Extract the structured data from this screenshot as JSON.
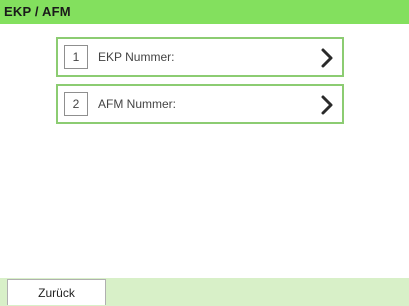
{
  "header": {
    "title": "EKP / AFM"
  },
  "menu": {
    "items": [
      {
        "number": "1",
        "label": "EKP Nummer:",
        "icon": "chevron-right-icon"
      },
      {
        "number": "2",
        "label": "AFM Nummer:",
        "icon": "chevron-right-icon"
      }
    ]
  },
  "footer": {
    "back_label": "Zurück"
  },
  "colors": {
    "title_bar": "#83e05e",
    "item_border": "#8ccc72",
    "footer_bar": "#d8f0c8"
  }
}
